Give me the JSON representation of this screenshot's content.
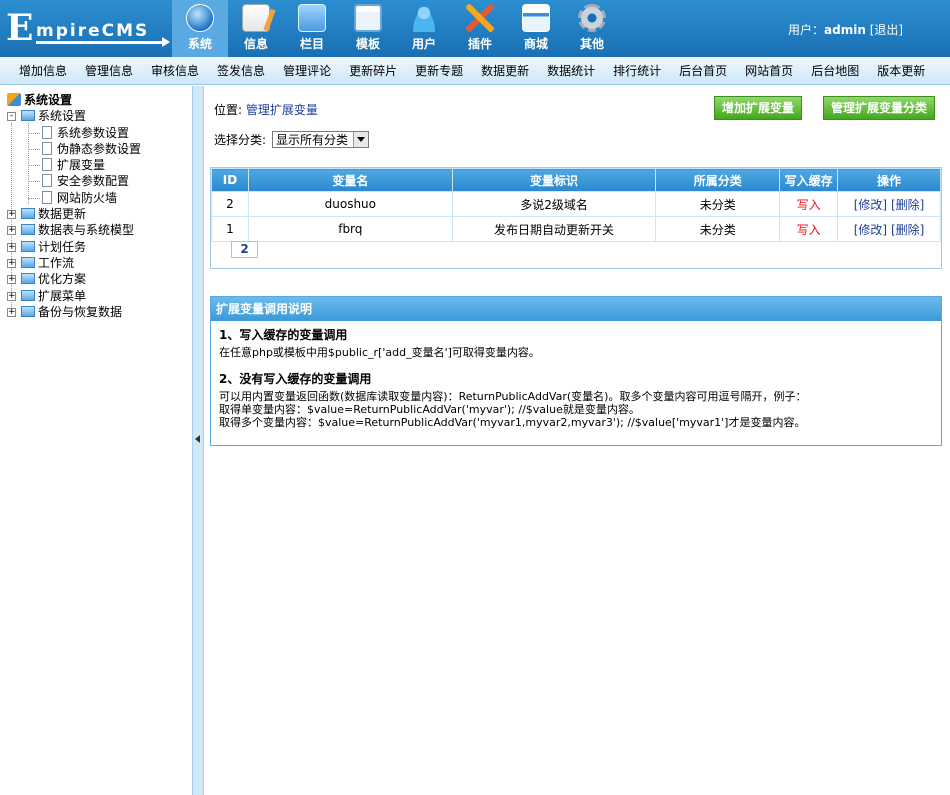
{
  "logo": {
    "initial": "E",
    "rest": "mpireCMS"
  },
  "nav": [
    {
      "label": "系统",
      "icon": "globe-icon",
      "active": true
    },
    {
      "label": "信息",
      "icon": "document-icon"
    },
    {
      "label": "栏目",
      "icon": "folder-icon"
    },
    {
      "label": "模板",
      "icon": "window-icon"
    },
    {
      "label": "用户",
      "icon": "user-icon"
    },
    {
      "label": "插件",
      "icon": "tools-icon"
    },
    {
      "label": "商城",
      "icon": "card-icon"
    },
    {
      "label": "其他",
      "icon": "gear-icon"
    }
  ],
  "user": {
    "prefix": "用户：",
    "name": "admin",
    "logout": "[退出]"
  },
  "submenu": [
    "增加信息",
    "管理信息",
    "审核信息",
    "签发信息",
    "管理评论",
    "更新碎片",
    "更新专题",
    "数据更新",
    "数据统计",
    "排行统计",
    "后台首页",
    "网站首页",
    "后台地图",
    "版本更新"
  ],
  "tree": {
    "root": "系统设置",
    "group": "系统设置",
    "children": [
      "系统参数设置",
      "伪静态参数设置",
      "扩展变量",
      "安全参数配置",
      "网站防火墙"
    ],
    "others": [
      "数据更新",
      "数据表与系统模型",
      "计划任务",
      "工作流",
      "优化方案",
      "扩展菜单",
      "备份与恢复数据"
    ]
  },
  "location": {
    "label": "位置: ",
    "link": "管理扩展变量"
  },
  "buttons": {
    "add": "增加扩展变量",
    "manage_class": "管理扩展变量分类"
  },
  "filter": {
    "label": "选择分类:",
    "selected": "显示所有分类"
  },
  "table": {
    "headers": [
      "ID",
      "变量名",
      "变量标识",
      "所属分类",
      "写入缓存",
      "操作"
    ],
    "rows": [
      {
        "id": "2",
        "name": "duoshuo",
        "title": "多说2级域名",
        "class": "未分类",
        "cache": "写入",
        "edit": "[修改]",
        "del": "[删除]"
      },
      {
        "id": "1",
        "name": "fbrq",
        "title": "发布日期自动更新开关",
        "class": "未分类",
        "cache": "写入",
        "edit": "[修改]",
        "del": "[删除]"
      }
    ],
    "page": "2"
  },
  "help": {
    "title": "扩展变量调用说明",
    "h1": "1、写入缓存的变量调用",
    "p1": "在任意php或模板中用$public_r['add_变量名']可取得变量内容。",
    "h2": "2、没有写入缓存的变量调用",
    "p2": "可以用内置变量返回函数(数据库读取变量内容)：ReturnPublicAddVar(变量名)。取多个变量内容可用逗号隔开，例子：",
    "p3": "取得单变量内容：$value=ReturnPublicAddVar('myvar'); //$value就是变量内容。",
    "p4": "取得多个变量内容：$value=ReturnPublicAddVar('myvar1,myvar2,myvar3'); //$value['myvar1']才是变量内容。"
  }
}
